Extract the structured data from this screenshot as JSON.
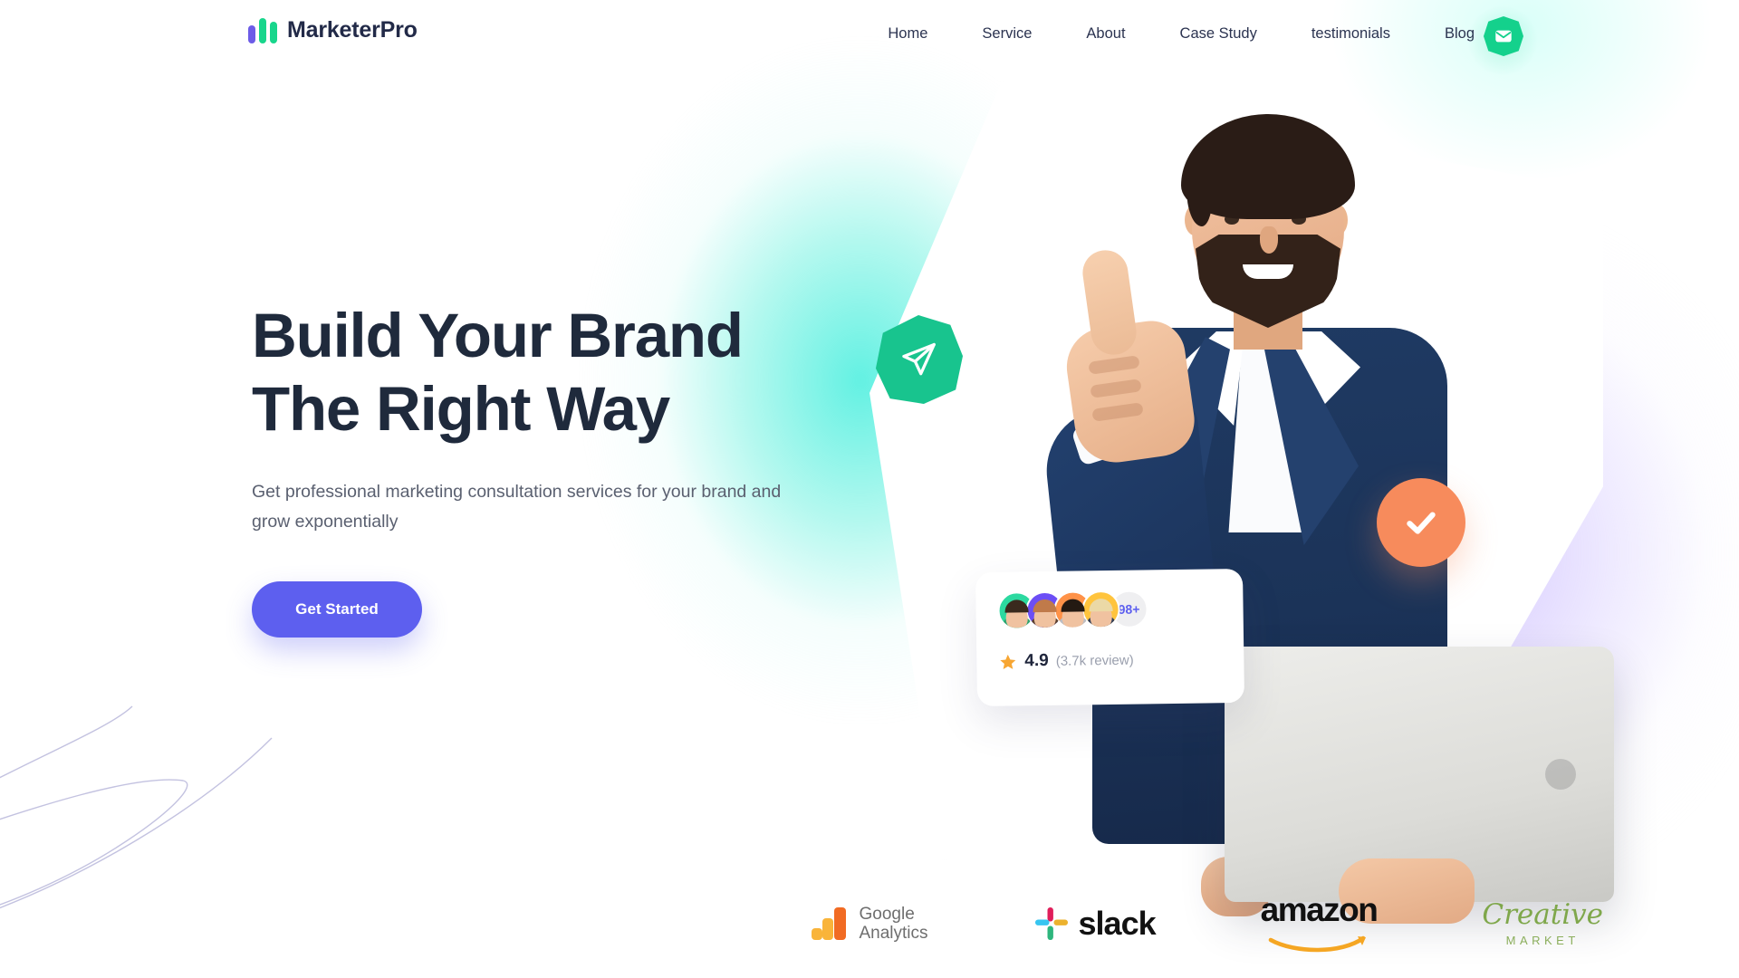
{
  "brand": {
    "name": "MarketerPro",
    "logo_icon": "three-bars-logo-icon",
    "colors": {
      "purple_bar": "#6C5CE7",
      "green_bar": "#18D68C",
      "wordmark": "#222A48"
    }
  },
  "nav": {
    "items": [
      {
        "label": "Home"
      },
      {
        "label": "Service"
      },
      {
        "label": "About"
      },
      {
        "label": "Case Study"
      },
      {
        "label": "testimonials"
      },
      {
        "label": "Blog"
      }
    ],
    "mail_button": {
      "icon": "envelope-icon",
      "color": "#14D18C"
    }
  },
  "hero": {
    "headline_line1": "Build Your Brand",
    "headline_line2": "The Right Way",
    "subhead": "Get professional marketing consultation services for your brand and grow exponentially",
    "cta_label": "Get Started",
    "cta_color": "#5D5FEF",
    "badges": {
      "send": {
        "icon": "paper-plane-icon",
        "color": "#18C48E"
      },
      "check": {
        "icon": "checkmark-icon",
        "color": "#F78B5C"
      }
    }
  },
  "review_card": {
    "avatars": [
      {
        "ring_color": "#2CD9A0",
        "hair": "#3A2A1E",
        "body": "#2FA36F"
      },
      {
        "ring_color": "#6C4EF5",
        "hair": "#C07A4A",
        "body": "#5A3F2E"
      },
      {
        "ring_color": "#FF9248",
        "hair": "#241A12",
        "body": "#B9BEC6"
      },
      {
        "ring_color": "#FFC43D",
        "hair": "#EBD9A6",
        "body": "#2D3B56"
      }
    ],
    "more_count": "98+",
    "more_count_color": "#5D5FEF",
    "star_icon": "star-icon",
    "star_color": "#F7A633",
    "score": "4.9",
    "review_count": "(3.7k review)"
  },
  "brands": [
    {
      "name": "Google Analytics",
      "line1": "Google",
      "line2": "Analytics",
      "icon": "google-analytics-icon"
    },
    {
      "name": "slack",
      "label": "slack",
      "icon": "slack-icon"
    },
    {
      "name": "amazon",
      "label": "amazon",
      "icon": "amazon-smile-icon"
    },
    {
      "name": "Creative Market",
      "script": "Creative",
      "sub": "MARKET",
      "color": "#7FA74B"
    }
  ]
}
